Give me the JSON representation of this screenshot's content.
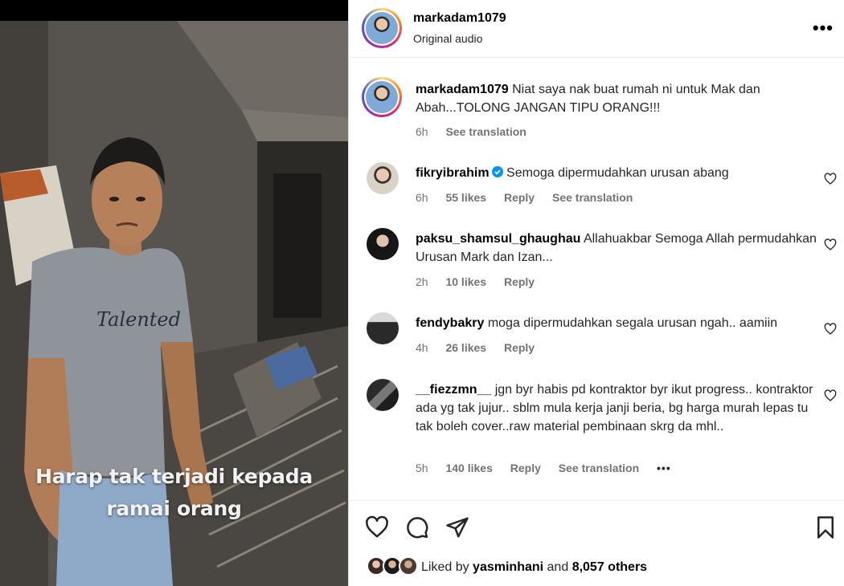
{
  "caption": {
    "line1": "Harap tak terjadi kepada",
    "line2": "ramai orang"
  },
  "tshirt_text": "Talented",
  "header": {
    "username": "markadam1079",
    "subtitle": "Original audio",
    "more_label": "•••"
  },
  "post": {
    "username": "markadam1079",
    "text": "Niat saya nak buat rumah ni untuk Mak dan Abah...TOLONG JANGAN TIPU ORANG!!!",
    "time": "6h",
    "translate": "See translation"
  },
  "comments": [
    {
      "username": "fikryibrahim",
      "verified": true,
      "text": "Semoga dipermudahkan urusan abang",
      "time": "6h",
      "likes": "55 likes",
      "reply": "Reply",
      "translate": "See translation"
    },
    {
      "username": "paksu_shamsul_ghaughau",
      "text": "Allahuakbar Semoga Allah permudahkan Urusan Mark dan Izan...",
      "time": "2h",
      "likes": "10 likes",
      "reply": "Reply"
    },
    {
      "username": "fendybakry",
      "text": "moga dipermudahkan segala urusan ngah.. aamiin",
      "time": "4h",
      "likes": "26 likes",
      "reply": "Reply"
    },
    {
      "username": "__fiezzmn__",
      "text": "jgn byr habis pd kontraktor byr ikut progress.. kontraktor ada yg tak jujur.. sblm mula kerja janji beria, bg harga murah lepas tu tak boleh cover..raw material pembinaan skrg da mhl..",
      "time": "5h",
      "likes": "140 likes",
      "reply": "Reply",
      "translate": "See translation",
      "more": "•••"
    }
  ],
  "actions": {
    "like_icon": "heart-icon",
    "comment_icon": "comment-icon",
    "share_icon": "send-icon",
    "save_icon": "bookmark-icon"
  },
  "likes": {
    "prefix": "Liked by",
    "user": "yasminhani",
    "and": "and",
    "others": "8,057 others"
  }
}
